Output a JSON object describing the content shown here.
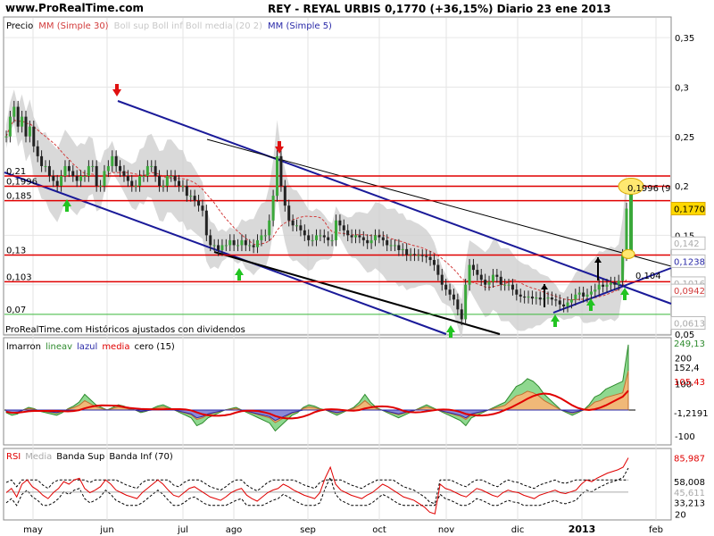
{
  "header": {
    "site": "www.ProRealTime.com",
    "title": "REY - REYAL URBIS     0,1770 (+36,15%)     Diario  23 ene 2013"
  },
  "chart_data": [
    {
      "type": "candlestick",
      "panel": "price",
      "legend": [
        {
          "label": "Precio",
          "color": "#000000"
        },
        {
          "label": "MM (Simple 30)",
          "color": "#d23c3c"
        },
        {
          "label": "Boll sup Boll inf Boll media (20 2)",
          "color": "#c8c8c8"
        },
        {
          "label": "MM (Simple 5)",
          "color": "#2a2aa8"
        }
      ],
      "ylim": [
        0.05,
        0.37
      ],
      "yticks": [
        "0,35",
        "0,3",
        "0,25",
        "0,2",
        "0,15",
        "0,1",
        "0,05"
      ],
      "x_months": [
        "may",
        "jun",
        "jul",
        "ago",
        "sep",
        "oct",
        "nov",
        "dic",
        "2013",
        "feb"
      ],
      "close_series": [
        0.25,
        0.27,
        0.28,
        0.26,
        0.27,
        0.25,
        0.26,
        0.24,
        0.23,
        0.22,
        0.22,
        0.21,
        0.205,
        0.2,
        0.21,
        0.22,
        0.215,
        0.21,
        0.205,
        0.21,
        0.21,
        0.22,
        0.22,
        0.2,
        0.2,
        0.215,
        0.22,
        0.23,
        0.22,
        0.215,
        0.21,
        0.205,
        0.2,
        0.2,
        0.21,
        0.21,
        0.22,
        0.22,
        0.21,
        0.2,
        0.2,
        0.21,
        0.21,
        0.205,
        0.2,
        0.2,
        0.19,
        0.19,
        0.185,
        0.18,
        0.175,
        0.15,
        0.14,
        0.14,
        0.135,
        0.14,
        0.14,
        0.145,
        0.14,
        0.14,
        0.145,
        0.14,
        0.14,
        0.138,
        0.145,
        0.15,
        0.15,
        0.165,
        0.19,
        0.23,
        0.2,
        0.18,
        0.165,
        0.16,
        0.16,
        0.155,
        0.15,
        0.145,
        0.145,
        0.15,
        0.15,
        0.148,
        0.145,
        0.145,
        0.165,
        0.16,
        0.155,
        0.15,
        0.148,
        0.15,
        0.148,
        0.145,
        0.142,
        0.145,
        0.15,
        0.148,
        0.145,
        0.14,
        0.14,
        0.14,
        0.135,
        0.136,
        0.13,
        0.131,
        0.13,
        0.13,
        0.129,
        0.128,
        0.125,
        0.12,
        0.11,
        0.1,
        0.095,
        0.09,
        0.085,
        0.075,
        0.065,
        0.1,
        0.12,
        0.115,
        0.11,
        0.105,
        0.1,
        0.103,
        0.11,
        0.108,
        0.1,
        0.1,
        0.1,
        0.095,
        0.09,
        0.088,
        0.087,
        0.088,
        0.086,
        0.087,
        0.085,
        0.086,
        0.087,
        0.085,
        0.084,
        0.08,
        0.078,
        0.082,
        0.085,
        0.09,
        0.092,
        0.088,
        0.09,
        0.093,
        0.095,
        0.1,
        0.098,
        0.1,
        0.102,
        0.1,
        0.104,
        0.13,
        0.177
      ],
      "levels": [
        {
          "value": 0.21,
          "label": "0,21",
          "color": "#e00000"
        },
        {
          "value": 0.1996,
          "label": "0,1996",
          "color": "#e00000"
        },
        {
          "value": 0.185,
          "label": "0,185",
          "color": "#e00000"
        },
        {
          "value": 0.13,
          "label": "0,13",
          "color": "#e00000"
        },
        {
          "value": 0.103,
          "label": "0,103",
          "color": "#e00000"
        },
        {
          "value": 0.07,
          "label": "0,07",
          "color": "#3ab83a"
        }
      ],
      "annotations": [
        "0,1996 (9",
        "0,104",
        "ProRealTime.com  Históricos ajustados con dividendos"
      ],
      "right_labels": [
        {
          "label": "0,1770",
          "bg": "#ffd800",
          "fg": "#000000",
          "value": 0.177
        },
        {
          "label": "0,142",
          "bg": "#ffffff",
          "fg": "#aaaaaa",
          "value": 0.142
        },
        {
          "label": "0,1238",
          "bg": "#ffffff",
          "fg": "#2a2aa8",
          "value": 0.1238
        },
        {
          "label": "0,1016",
          "bg": "#ffffff",
          "fg": "#aaaaaa",
          "value": 0.1016
        },
        {
          "label": "0,0942",
          "bg": "#ffffff",
          "fg": "#d23c3c",
          "value": 0.0942
        },
        {
          "label": "0,0613",
          "bg": "#ffffff",
          "fg": "#aaaaaa",
          "value": 0.0613
        }
      ]
    },
    {
      "type": "area",
      "panel": "indicator",
      "legend": [
        {
          "label": "lmarron",
          "color": "#000000"
        },
        {
          "label": "lineav",
          "color": "#2e8b2e"
        },
        {
          "label": "lazul",
          "color": "#2a2aa8"
        },
        {
          "label": "media",
          "color": "#e00000"
        },
        {
          "label": "cero (15)",
          "color": "#000000"
        }
      ],
      "ylim": [
        -130,
        270
      ],
      "yticks": [
        "200",
        "100",
        "-100"
      ],
      "right_labels": [
        {
          "label": "249,13",
          "color": "#2e8b2e"
        },
        {
          "label": "152,4",
          "color": "#000000"
        },
        {
          "label": "105,43",
          "color": "#e00000"
        },
        {
          "label": "-1,2191",
          "color": "#000000"
        }
      ],
      "values": [
        -10,
        -20,
        -15,
        0,
        10,
        5,
        -5,
        -10,
        -15,
        -20,
        -10,
        5,
        15,
        30,
        60,
        40,
        20,
        10,
        0,
        10,
        20,
        15,
        5,
        0,
        -10,
        -5,
        5,
        15,
        20,
        10,
        0,
        -10,
        -20,
        -30,
        -60,
        -50,
        -30,
        -20,
        -10,
        0,
        5,
        10,
        0,
        -10,
        -20,
        -30,
        -40,
        -50,
        -80,
        -60,
        -40,
        -20,
        -10,
        10,
        20,
        15,
        5,
        0,
        -10,
        -20,
        -10,
        0,
        10,
        30,
        60,
        30,
        10,
        0,
        -10,
        -20,
        -30,
        -20,
        -10,
        0,
        10,
        20,
        10,
        0,
        -10,
        -20,
        -30,
        -40,
        -60,
        -30,
        -20,
        -10,
        0,
        10,
        20,
        30,
        60,
        90,
        100,
        120,
        110,
        90,
        60,
        40,
        20,
        0,
        -10,
        -20,
        -10,
        0,
        20,
        50,
        60,
        80,
        90,
        100,
        110,
        250
      ]
    },
    {
      "type": "line",
      "panel": "rsi",
      "legend": [
        {
          "label": "RSI",
          "color": "#e00000"
        },
        {
          "label": "Media",
          "color": "#aaaaaa"
        },
        {
          "label": "Banda Sup",
          "color": "#000000"
        },
        {
          "label": "Banda Inf (70)",
          "color": "#000000"
        }
      ],
      "ylim": [
        15,
        95
      ],
      "yticks": [
        "20"
      ],
      "right_labels": [
        {
          "label": "85,987",
          "color": "#e00000",
          "value": 85.987
        },
        {
          "label": "58,008",
          "color": "#000000",
          "value": 58.008
        },
        {
          "label": "45,611",
          "color": "#aaaaaa",
          "value": 45.611
        },
        {
          "label": "33,213",
          "color": "#000000",
          "value": 33.213
        }
      ],
      "values": [
        45,
        50,
        40,
        55,
        60,
        52,
        48,
        42,
        38,
        45,
        50,
        58,
        55,
        60,
        62,
        50,
        45,
        48,
        52,
        60,
        55,
        48,
        45,
        42,
        40,
        38,
        45,
        50,
        55,
        60,
        55,
        48,
        42,
        40,
        45,
        50,
        52,
        48,
        44,
        40,
        38,
        36,
        40,
        45,
        48,
        50,
        42,
        38,
        35,
        40,
        45,
        48,
        50,
        55,
        52,
        48,
        45,
        42,
        40,
        38,
        45,
        62,
        75,
        55,
        48,
        45,
        42,
        40,
        38,
        42,
        45,
        50,
        55,
        52,
        48,
        44,
        40,
        38,
        36,
        32,
        28,
        22,
        20,
        55,
        50,
        48,
        45,
        42,
        40,
        45,
        50,
        48,
        45,
        42,
        40,
        45,
        48,
        46,
        45,
        42,
        40,
        38,
        42,
        44,
        46,
        48,
        45,
        44,
        46,
        48,
        55,
        60,
        58,
        62,
        65,
        68,
        70,
        72,
        75,
        86
      ]
    }
  ],
  "colors": {
    "level_red": "#e00000",
    "level_green": "#3ab83a",
    "channel": "#1a1a99",
    "up_arrow": "#22c422",
    "down_arrow": "#e01010"
  }
}
